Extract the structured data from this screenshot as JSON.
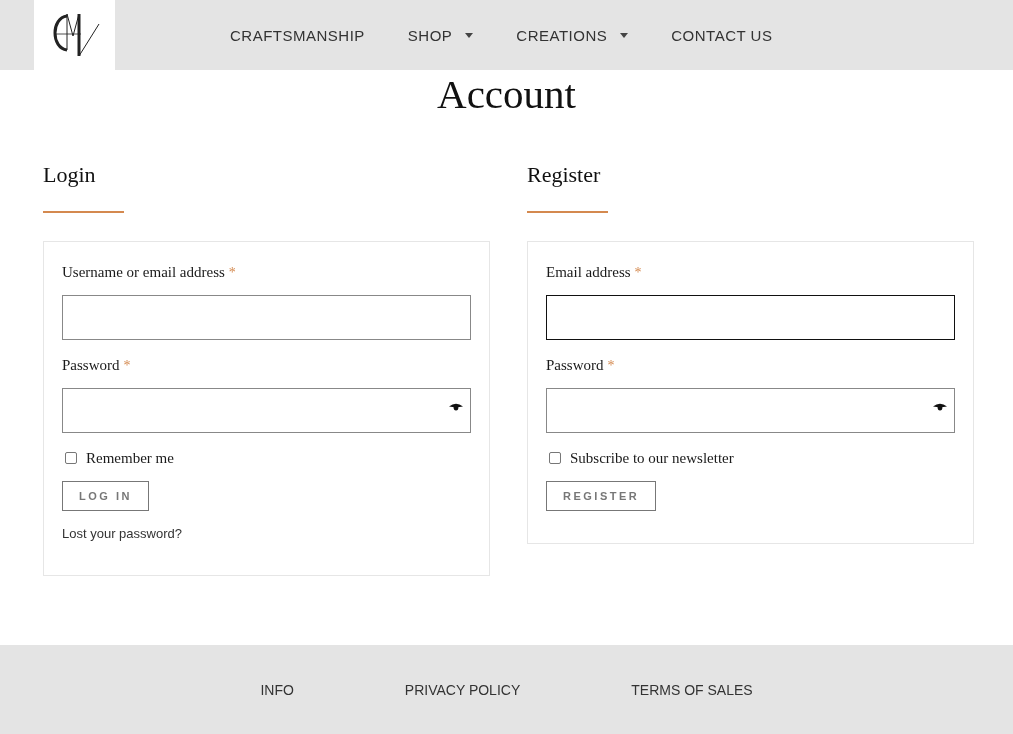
{
  "header": {
    "nav": [
      {
        "label": "CRAFTSMANSHIP",
        "has_dropdown": false
      },
      {
        "label": "SHOP",
        "has_dropdown": true
      },
      {
        "label": "CREATIONS",
        "has_dropdown": true
      },
      {
        "label": "CONTACT US",
        "has_dropdown": false
      }
    ]
  },
  "page_title": "Account",
  "sections": [
    {
      "heading": "Login",
      "fields": [
        {
          "label": "Username or email address",
          "required_mark": "*",
          "kind": "text",
          "focused": false
        },
        {
          "label": "Password",
          "required_mark": "*",
          "kind": "password",
          "focused": false
        }
      ],
      "checkbox": {
        "label": "Remember me",
        "checked": false
      },
      "button": "LOG IN",
      "link": "Lost your password?"
    },
    {
      "heading": "Register",
      "fields": [
        {
          "label": "Email address",
          "required_mark": "*",
          "kind": "text",
          "focused": true
        },
        {
          "label": "Password",
          "required_mark": "*",
          "kind": "password",
          "focused": false
        }
      ],
      "checkbox": {
        "label": "Subscribe to our newsletter",
        "checked": false
      },
      "button": "REGISTER"
    }
  ],
  "footer": {
    "links": [
      "INFO",
      "PRIVACY POLICY",
      "TERMS OF SALES"
    ]
  }
}
